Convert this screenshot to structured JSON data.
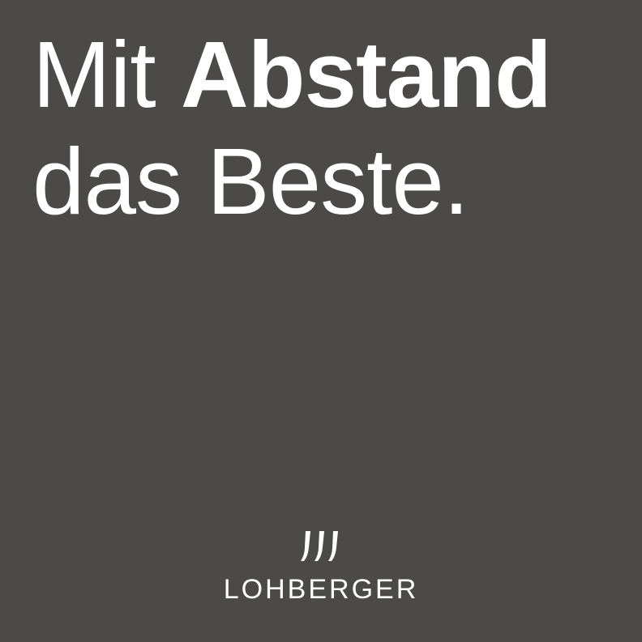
{
  "headline": {
    "word1": "Mit",
    "word2": "Abstand",
    "line2": "das Beste."
  },
  "brand": {
    "name": "LOHBERGER",
    "mark_icon": "three-flames-icon"
  },
  "colors": {
    "background": "#4b4a49",
    "text": "#ffffff"
  }
}
